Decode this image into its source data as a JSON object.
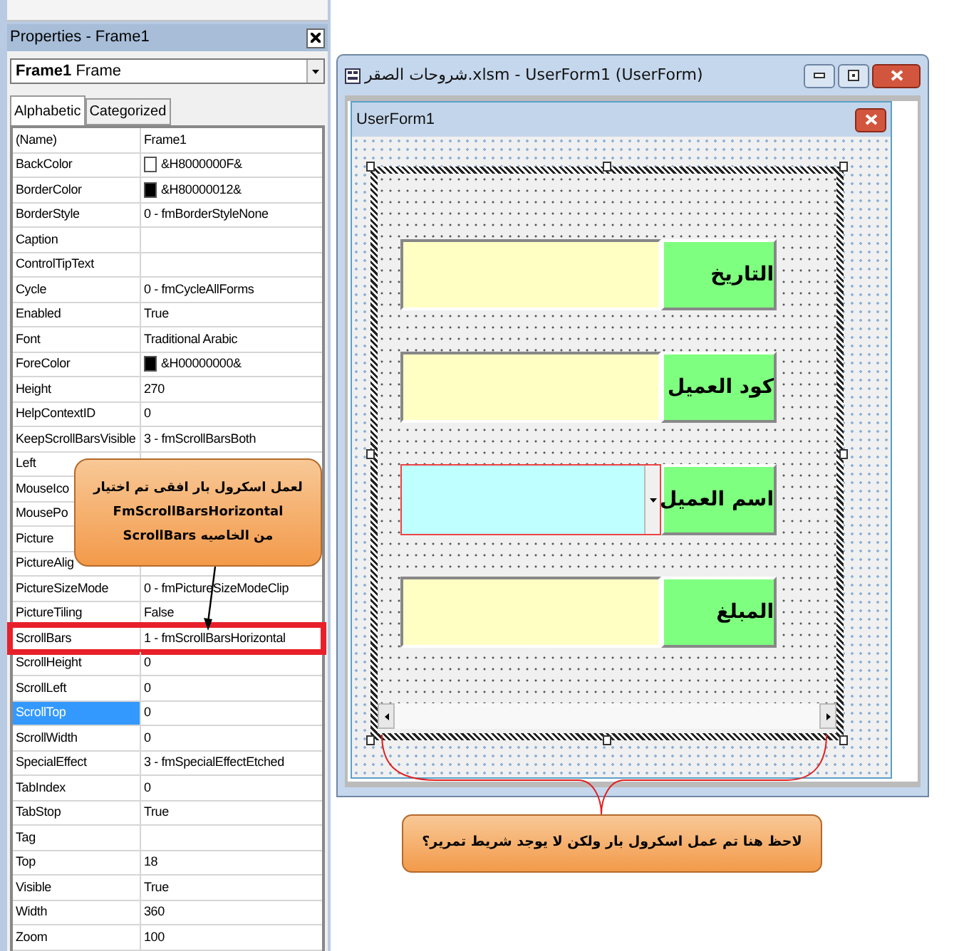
{
  "properties_window": {
    "title": "Properties - Frame1",
    "object_selector": {
      "name": "Frame1",
      "type": "Frame"
    },
    "tabs": [
      {
        "label": "Alphabetic",
        "selected": true
      },
      {
        "label": "Categorized",
        "selected": false
      }
    ],
    "properties": [
      {
        "name": "(Name)",
        "value": "Frame1",
        "selected": false,
        "highlighted": false
      },
      {
        "name": "BackColor",
        "value": "&H8000000F&",
        "color": "#ffffff",
        "selected": false,
        "highlighted": false
      },
      {
        "name": "BorderColor",
        "value": "&H80000012&",
        "color": "#000000",
        "selected": false,
        "highlighted": false
      },
      {
        "name": "BorderStyle",
        "value": "0 - fmBorderStyleNone",
        "selected": false,
        "highlighted": false
      },
      {
        "name": "Caption",
        "selected": false,
        "highlighted": false
      },
      {
        "name": "ControlTipText",
        "selected": false,
        "highlighted": false
      },
      {
        "name": "Cycle",
        "value": "0 - fmCycleAllForms",
        "selected": false,
        "highlighted": false
      },
      {
        "name": "Enabled",
        "value": "True",
        "selected": false,
        "highlighted": false
      },
      {
        "name": "Font",
        "value": "Traditional Arabic",
        "selected": false,
        "highlighted": false
      },
      {
        "name": "ForeColor",
        "value": "&H00000000&",
        "color": "#000000",
        "selected": false,
        "highlighted": false
      },
      {
        "name": "Height",
        "value": "270",
        "selected": false,
        "highlighted": false
      },
      {
        "name": "HelpContextID",
        "value": "0",
        "selected": false,
        "highlighted": false
      },
      {
        "name": "KeepScrollBarsVisible",
        "value": "3 - fmScrollBarsBoth",
        "selected": false,
        "highlighted": false
      },
      {
        "name": "Left",
        "selected": false,
        "highlighted": false
      },
      {
        "name": "MouseIco",
        "selected": false,
        "highlighted": false
      },
      {
        "name": "MousePo",
        "selected": false,
        "highlighted": false
      },
      {
        "name": "Picture",
        "selected": false,
        "highlighted": false
      },
      {
        "name": "PictureAlig",
        "selected": false,
        "highlighted": false
      },
      {
        "name": "PictureSizeMode",
        "value": "0 - fmPictureSizeModeClip",
        "selected": false,
        "highlighted": false
      },
      {
        "name": "PictureTiling",
        "value": "False",
        "selected": false,
        "highlighted": false
      },
      {
        "name": "ScrollBars",
        "value": "1 - fmScrollBarsHorizontal",
        "selected": false,
        "highlighted": true
      },
      {
        "name": "ScrollHeight",
        "value": "0",
        "selected": false,
        "highlighted": false
      },
      {
        "name": "ScrollLeft",
        "value": "0",
        "selected": false,
        "highlighted": false
      },
      {
        "name": "ScrollTop",
        "value": "0",
        "selected": true,
        "highlighted": false
      },
      {
        "name": "ScrollWidth",
        "value": "0",
        "selected": false,
        "highlighted": false
      },
      {
        "name": "SpecialEffect",
        "value": "3 - fmSpecialEffectEtched",
        "selected": false,
        "highlighted": false
      },
      {
        "name": "TabIndex",
        "value": "0",
        "selected": false,
        "highlighted": false
      },
      {
        "name": "TabStop",
        "value": "True",
        "selected": false,
        "highlighted": false
      },
      {
        "name": "Tag",
        "selected": false,
        "highlighted": false
      },
      {
        "name": "Top",
        "value": "18",
        "selected": false,
        "highlighted": false
      },
      {
        "name": "Visible",
        "value": "True",
        "selected": false,
        "highlighted": false
      },
      {
        "name": "Width",
        "value": "360",
        "selected": false,
        "highlighted": false
      },
      {
        "name": "Zoom",
        "value": "100",
        "selected": false,
        "highlighted": false
      }
    ]
  },
  "designer_window": {
    "title": "شروحات الصقر.xlsm - UserForm1 (UserForm)",
    "userform": {
      "title": "UserForm1",
      "fields": [
        {
          "kind": "textbox",
          "label": "التاريخ"
        },
        {
          "kind": "textbox",
          "label": "كود العميل"
        },
        {
          "kind": "combobox",
          "label": "اسم العميل"
        },
        {
          "kind": "textbox",
          "label": "المبلغ"
        }
      ]
    }
  },
  "callouts": [
    {
      "lines": [
        "لعمل اسكرول بار افقى تم اختيار",
        "**FmScrollBarsHorizontal**",
        "من الخاصيه  **ScrollBars**"
      ]
    },
    {
      "lines": [
        "لاحظ هنا تم عمل  اسكرول بار ولكن لا يوجد شريط تمرير؟"
      ]
    }
  ]
}
